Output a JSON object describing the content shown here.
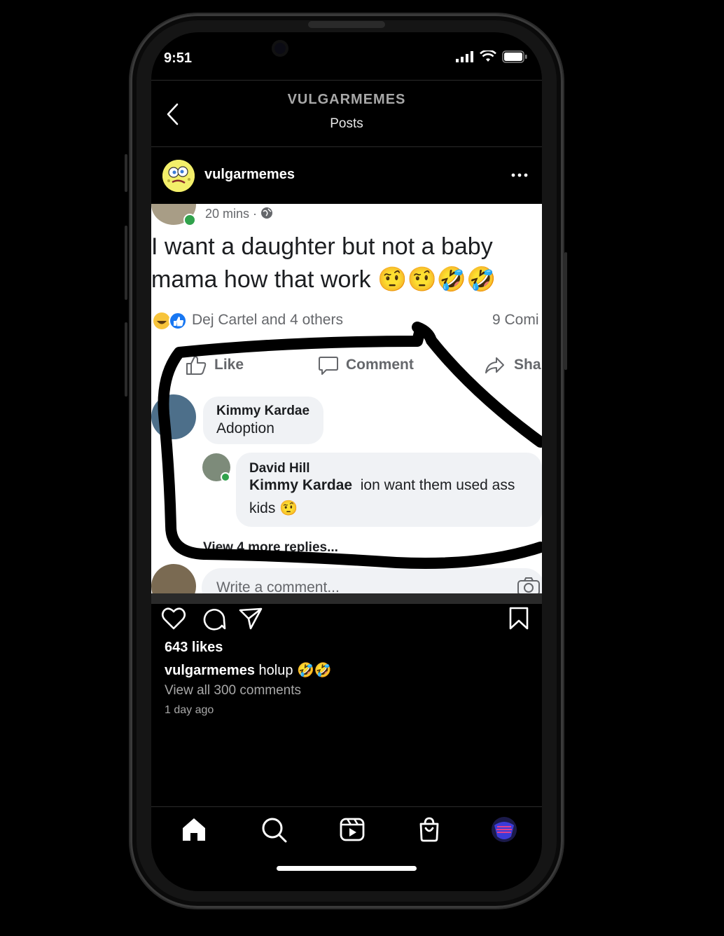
{
  "status": {
    "time": "9:51"
  },
  "header": {
    "title": "VULGARMEMES",
    "subtitle": "Posts"
  },
  "post": {
    "username": "vulgarmemes",
    "image": {
      "time": "20 mins ·",
      "text": "I want a daughter but not a baby mama how that work 🤨🤨🤣🤣",
      "reactions": "Dej Cartel and 4 others",
      "comments_count": "9 Comi",
      "actions": {
        "like": "Like",
        "comment": "Comment",
        "share": "Sha"
      },
      "comment1": {
        "name": "Kimmy Kardae",
        "text": "Adoption"
      },
      "comment2": {
        "name": "David Hill",
        "mention": "Kimmy Kardae",
        "text": "ion want them used ass",
        "text2": "kids 🤨"
      },
      "more_replies": "View 4 more replies...",
      "write_placeholder": "Write a comment..."
    },
    "likes": "643 likes",
    "caption_user": "vulgarmemes",
    "caption_text": "holup 🤣🤣",
    "view_all": "View all 300 comments",
    "time_ago": "1 day ago"
  },
  "icons": {
    "back": "chevron-left-icon",
    "more": "ellipsis-icon",
    "like": "heart-icon",
    "comment": "comment-icon",
    "share": "send-icon",
    "save": "bookmark-icon",
    "home": "home-icon",
    "search": "search-icon",
    "reels": "reels-icon",
    "shop": "shop-icon",
    "profile": "profile-avatar"
  }
}
